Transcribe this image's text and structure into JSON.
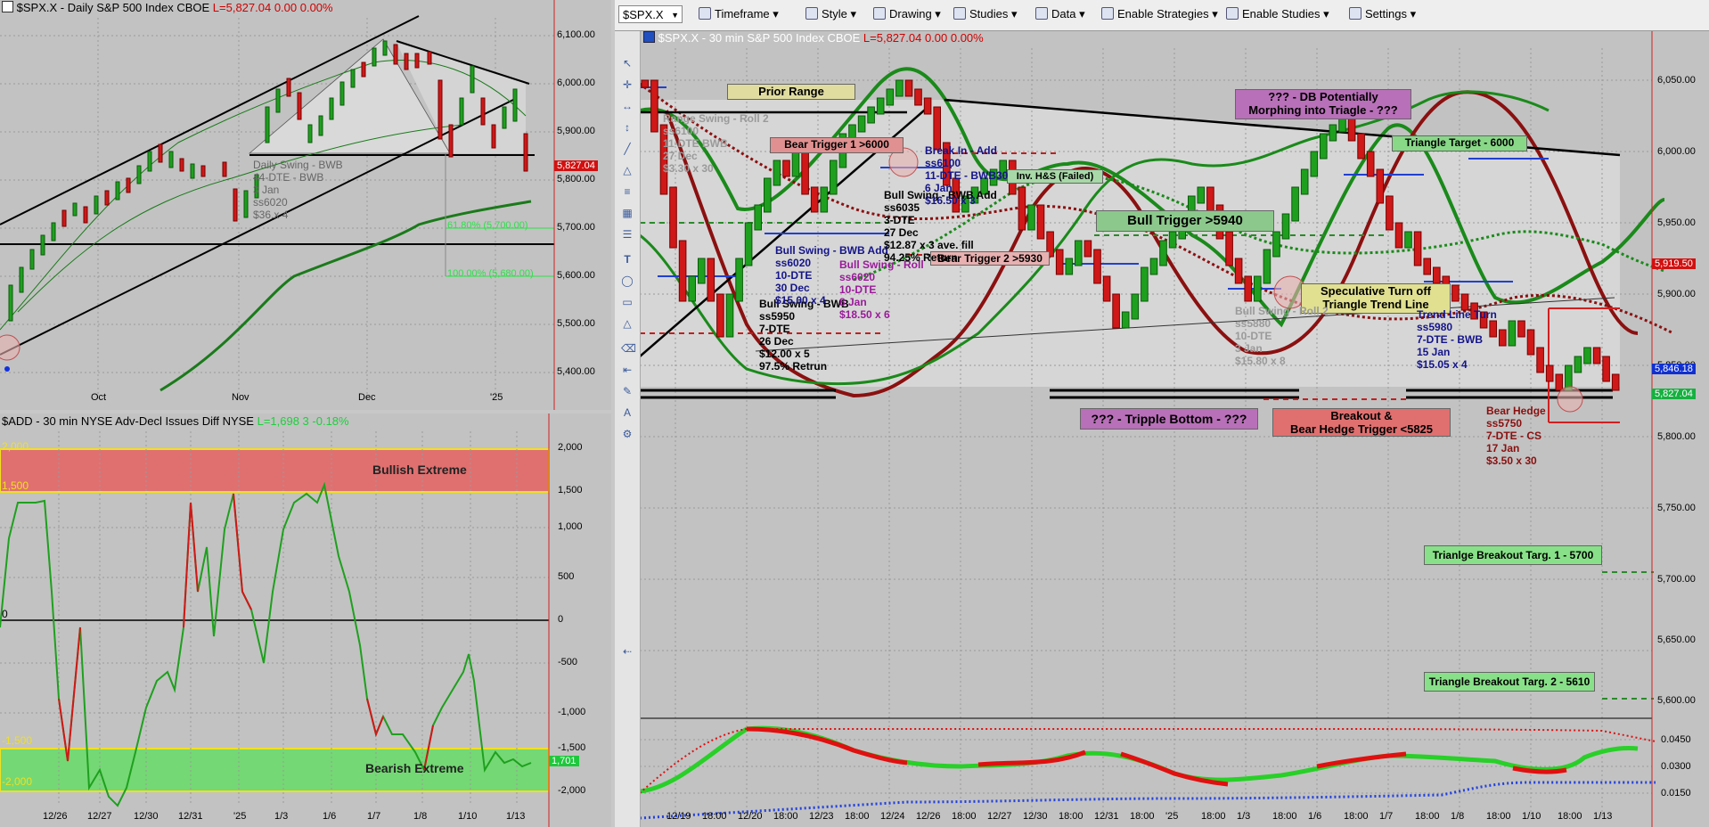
{
  "daily_pane": {
    "title_main": "$SPX.X - Daily  S&P 500 Index  CBOE",
    "title_vals": "L=5,827.04  0.00  0.00%",
    "y_labels": [
      "6,100.00",
      "6,000.00",
      "5,900.00",
      "5,800.00",
      "5,700.00",
      "5,600.00",
      "5,500.00",
      "5,400.00"
    ],
    "x_labels": [
      "Oct",
      "Nov",
      "Dec",
      "'25"
    ],
    "last_price": "5,827.04",
    "annotations": [
      {
        "text": "Daily Swing - BWB"
      },
      {
        "text": "44-DTE - BWB"
      },
      {
        "text": "3 Jan"
      },
      {
        "text": "ss6020"
      },
      {
        "text": "$36.x 4"
      },
      {
        "text": "61.80% (5,700.00)"
      },
      {
        "text": "100.00% (5,680.00)"
      }
    ]
  },
  "add_pane": {
    "title_main": "$ADD - 30 min  NYSE Adv-Decl Issues Diff  NYSE",
    "title_vals": "L=1,698  3  -0.18%",
    "y_labels": [
      "2,000",
      "1,500",
      "1,000",
      "500",
      "0",
      "-500",
      "-1,000",
      "-1,500",
      "-2,000"
    ],
    "x_labels": [
      "12/26",
      "12/27",
      "12/30",
      "12/31",
      "'25",
      "1/3",
      "1/6",
      "1/7",
      "1/8",
      "1/10",
      "1/13"
    ],
    "band_labels": [
      "2,000",
      "1,500",
      "-1,500",
      "-2,000"
    ],
    "bullish_label": "Bullish Extreme",
    "bearish_label": "Bearish Extreme",
    "last_value": "1,701",
    "zero_marker": "0"
  },
  "toolbar": {
    "symbol": "$SPX.X",
    "items": [
      "Timeframe",
      "Style",
      "Drawing",
      "Studies",
      "Data",
      "Enable Strategies",
      "Enable Studies",
      "Settings"
    ]
  },
  "main_pane": {
    "title_main": "$SPX.X - 30 min  S&P 500 Index  CBOE",
    "title_vals": "L=5,827.04  0.00  0.00%",
    "y_labels": [
      "6,050.00",
      "6,000.00",
      "5,950.00",
      "5,900.00",
      "5,850.00",
      "5,800.00",
      "5,750.00",
      "5,700.00",
      "5,650.00",
      "5,600.00"
    ],
    "price_tags": [
      {
        "text": "5,919.50",
        "color": "#d21010"
      },
      {
        "text": "5,846.18",
        "color": "#1030d0"
      },
      {
        "text": "5,827.04",
        "color": "#16b040"
      }
    ],
    "x_labels": [
      "12/19",
      "18:00",
      "12/20",
      "18:00",
      "12/23",
      "18:00",
      "12/24",
      "12/26",
      "18:00",
      "12/27",
      "12/30",
      "18:00",
      "12/31",
      "18:00",
      "'25",
      "18:00",
      "1/3",
      "18:00",
      "1/6",
      "18:00",
      "1/7",
      "18:00",
      "1/8",
      "18:00",
      "1/10",
      "18:00",
      "1/13"
    ],
    "lower_y_labels": [
      "0.0450",
      "0.0300",
      "0.0150"
    ],
    "boxes": {
      "prior_range": "Prior Range",
      "bear_trigger_1": "Bear Trigger 1 >6000",
      "bear_trigger_2": "Bear Trigger 2 >5930",
      "bull_trigger": "Bull Trigger >5940",
      "db_line1": "??? - DB Potentially",
      "db_line2": "Morphing into Triagle - ???",
      "triangle_target": "Triangle Target - 6000",
      "speculative_line1": "Speculative Turn off",
      "speculative_line2": "Triangle Trend Line",
      "tripple_bottom": "??? - Tripple Bottom - ???",
      "breakout_line1": "Breakout &",
      "breakout_line2": "Bear Hedge Trigger <5825",
      "targ1": "Trianlge Breakout Targ. 1 - 5700",
      "targ2": "Triangle Breakout Targ. 2 - 5610",
      "inv_hs": "Inv. H&S (Failed)"
    },
    "notes": {
      "range_lines": [
        "Range Swing - Roll 2",
        "ss6100",
        "11-DTE BWB",
        "27 Dec",
        "$3.30 x 30"
      ],
      "bull_swing_1": [
        "Bull Swing - BWB",
        "ss5950",
        "7-DTE",
        "26 Dec",
        "$12.00 x 5",
        "97.5% Retrun"
      ],
      "bull_swing_2": [
        "Bull Swing - BWB Add",
        "ss6020",
        "10-DTE",
        "30 Dec",
        "$15.00 x 4"
      ],
      "bull_swing_roll": [
        "Bull Swing - Roll",
        "ss6020",
        "10-DTE",
        "8 Jan",
        "$18.50 x 6"
      ],
      "bull_swing_3": [
        "Bull Swing - BWB Add",
        "ss6035",
        "3-DTE",
        "27 Dec",
        "$12.87 x 3 ave. fill",
        "94.25% Return"
      ],
      "break_in": [
        "Break In - Add",
        "ss6100",
        "11-DTE - BWB30",
        "6 Jan",
        "$16.50 x 3"
      ],
      "bull_swing_roll2": [
        "Bull Swing - Roll 2",
        "ss5880",
        "10-DTE",
        "3 Jan",
        "$15.80 x 8"
      ],
      "trend_line": [
        "Trend Line Turn",
        "ss5980",
        "7-DTE - BWB",
        "15 Jan",
        "$15.05 x 4"
      ],
      "bear_hedge": [
        "Bear Hedge",
        "ss5750",
        "7-DTE - CS",
        "17 Jan",
        "$3.50 x 30"
      ]
    }
  }
}
